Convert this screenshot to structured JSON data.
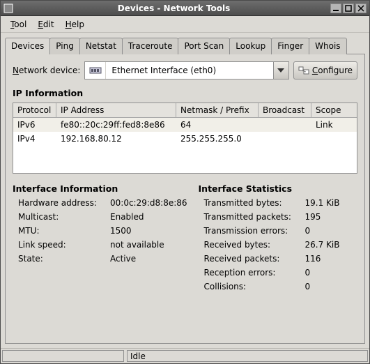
{
  "window": {
    "title": "Devices - Network Tools"
  },
  "menu": {
    "tool": "Tool",
    "edit": "Edit",
    "help": "Help"
  },
  "tabs": [
    "Devices",
    "Ping",
    "Netstat",
    "Traceroute",
    "Port Scan",
    "Lookup",
    "Finger",
    "Whois"
  ],
  "device_row": {
    "label": "Network device:",
    "selected": "Ethernet Interface (eth0)",
    "configure_label": "Configure"
  },
  "ip_info": {
    "heading": "IP Information",
    "headers": {
      "protocol": "Protocol",
      "ip": "IP Address",
      "mask": "Netmask / Prefix",
      "bcast": "Broadcast",
      "scope": "Scope"
    },
    "rows": [
      {
        "protocol": "IPv6",
        "ip": "fe80::20c:29ff:fed8:8e86",
        "mask": "64",
        "bcast": "",
        "scope": "Link"
      },
      {
        "protocol": "IPv4",
        "ip": "192.168.80.12",
        "mask": "255.255.255.0",
        "bcast": "",
        "scope": ""
      }
    ]
  },
  "iface_info": {
    "heading": "Interface Information",
    "hw_addr_k": "Hardware address:",
    "hw_addr_v": "00:0c:29:d8:8e:86",
    "multicast_k": "Multicast:",
    "multicast_v": "Enabled",
    "mtu_k": "MTU:",
    "mtu_v": "1500",
    "link_k": "Link speed:",
    "link_v": "not available",
    "state_k": "State:",
    "state_v": "Active"
  },
  "iface_stats": {
    "heading": "Interface Statistics",
    "txb_k": "Transmitted bytes:",
    "txb_v": "19.1 KiB",
    "txp_k": "Transmitted packets:",
    "txp_v": "195",
    "txe_k": "Transmission errors:",
    "txe_v": "0",
    "rxb_k": "Received bytes:",
    "rxb_v": "26.7 KiB",
    "rxp_k": "Received packets:",
    "rxp_v": "116",
    "rxe_k": "Reception errors:",
    "rxe_v": "0",
    "col_k": "Collisions:",
    "col_v": "0"
  },
  "status": {
    "text": "Idle"
  }
}
